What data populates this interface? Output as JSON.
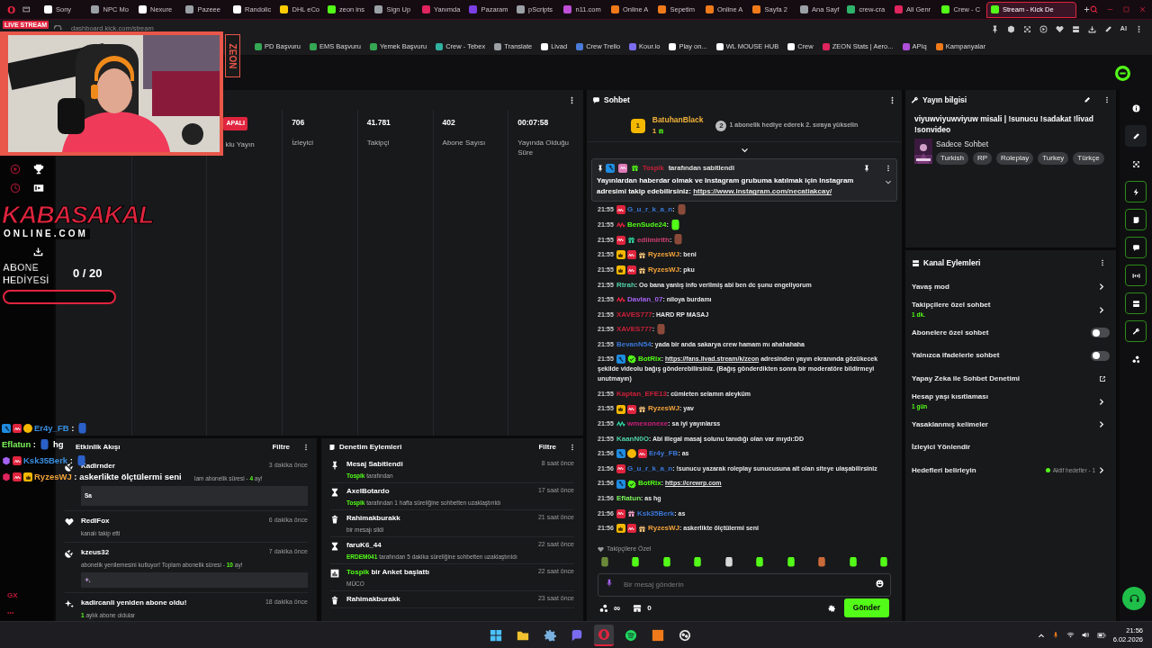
{
  "browser": {
    "tabs": [
      {
        "label": "Sony",
        "color": "#ffffff",
        "selected": false
      },
      {
        "label": "NPC Mo",
        "color": "#9aa0a6",
        "selected": false
      },
      {
        "label": "Nexure",
        "color": "#ffffff",
        "selected": false
      },
      {
        "label": "Pazeee",
        "color": "#9aa0a6",
        "selected": false
      },
      {
        "label": "Randolic",
        "color": "#ffffff",
        "selected": false
      },
      {
        "label": "DHL eCo",
        "color": "#ffcc00",
        "selected": false
      },
      {
        "label": "zeon ins",
        "color": "#53fc18",
        "selected": false
      },
      {
        "label": "Sign Up",
        "color": "#9aa0a6",
        "selected": false
      },
      {
        "label": "Yanımda",
        "color": "#e0245e",
        "selected": false
      },
      {
        "label": "Pazaram",
        "color": "#7b3fe4",
        "selected": false
      },
      {
        "label": "pScripts",
        "color": "#9aa0a6",
        "selected": false
      },
      {
        "label": "n11.com",
        "color": "#c04fd8",
        "selected": false
      },
      {
        "label": "Online A",
        "color": "#f07a1a",
        "selected": false
      },
      {
        "label": "Sepetim",
        "color": "#f07a1a",
        "selected": false
      },
      {
        "label": "Online A",
        "color": "#f07a1a",
        "selected": false
      },
      {
        "label": "Sayfa 2",
        "color": "#f07a1a",
        "selected": false
      },
      {
        "label": "Ana Sayf",
        "color": "#9aa0a6",
        "selected": false
      },
      {
        "label": "crew-cra",
        "color": "#2fb36b",
        "selected": false
      },
      {
        "label": "All Genr",
        "color": "#e0245e",
        "selected": false
      },
      {
        "label": "Crew - C",
        "color": "#53fc18",
        "selected": false
      },
      {
        "label": "Stream - Kick De",
        "color": "#53fc18",
        "selected": true
      }
    ],
    "address": "dashboard.kick.com/stream",
    "ai_label": "AI",
    "bookmarks": [
      {
        "label": "PD Başvuru",
        "color": "#34a853"
      },
      {
        "label": "EMS Başvuru",
        "color": "#34a853"
      },
      {
        "label": "Yemek Başvuru",
        "color": "#34a853"
      },
      {
        "label": "Crew - Tebex",
        "color": "#2fb3a0"
      },
      {
        "label": "Translate",
        "color": "#9aa0a6"
      },
      {
        "label": "Livad",
        "color": "#ffffff"
      },
      {
        "label": "Crew Trello",
        "color": "#4a7bd8"
      },
      {
        "label": "Kour.io",
        "color": "#7b6cf0"
      },
      {
        "label": "Play on...",
        "color": "#ffffff"
      },
      {
        "label": "WL MOUSE HUB",
        "color": "#ffffff"
      },
      {
        "label": "Crew",
        "color": "#ffffff"
      },
      {
        "label": "ZEON Stats | Aero...",
        "color": "#e0245e"
      },
      {
        "label": "APIq",
        "color": "#b04fd8"
      },
      {
        "label": "Kampanyalar",
        "color": "#f07a1a"
      }
    ]
  },
  "overlay": {
    "live_label": "LIVE STREAM",
    "side_tag": "ZEON",
    "brand": "KABASAKAL",
    "brand_sub": "ONLINE.COM",
    "goal_label": "ABONE HEDİYESİ",
    "goal_count": "0 / 20",
    "goal": {
      "level": 0
    },
    "chat": [
      {
        "badges": [
          {
            "kind": "mod",
            "color": "#1f8ce0"
          },
          {
            "kind": "og",
            "color": "#e0243e"
          },
          {
            "kind": "coin",
            "color": "#f5b800"
          }
        ],
        "user": "Er4y_FB",
        "color": "#3a8fe0",
        "parts": [
          {
            "kind": "text",
            "text": " :"
          },
          {
            "kind": "emote",
            "color": "#2a60c8"
          }
        ]
      },
      {
        "user": "Eflatun",
        "color": "#7cf25a",
        "parts": [
          {
            "kind": "text",
            "text": " :"
          },
          {
            "kind": "emote",
            "color": "#2a60c8"
          },
          {
            "kind": "text",
            "text": "hg"
          }
        ]
      },
      {
        "badges": [
          {
            "kind": "cube",
            "color": "#a463f2"
          },
          {
            "kind": "og",
            "color": "#e0243e"
          }
        ],
        "user": "Ksk35Berk",
        "color": "#3a8fe0",
        "parts": [
          {
            "kind": "text",
            "text": " :"
          },
          {
            "kind": "emote",
            "color": "#2a60c8"
          }
        ]
      },
      {
        "badges": [
          {
            "kind": "cube",
            "color": "#e0245e"
          },
          {
            "kind": "og",
            "color": "#e0243e"
          },
          {
            "kind": "crown",
            "color": "#f5b800"
          }
        ],
        "user": "RyzesWJ",
        "color": "#f2a33a",
        "parts": [
          {
            "kind": "text",
            "text": " : askerlikte ölçtülermi seni"
          }
        ]
      }
    ]
  },
  "stats_panel": {
    "status_badge": "APALI",
    "multistream_label": "klu Yayın",
    "stats": [
      {
        "value": "706",
        "label": "İzleyici"
      },
      {
        "value": "41.781",
        "label": "Takipçi"
      },
      {
        "value": "402",
        "label": "Abone Sayısı"
      },
      {
        "value": "00:07:58",
        "label": "Yayında Olduğu Süre"
      }
    ]
  },
  "event_feed": {
    "title": "Etkinlik Akışı",
    "filter": "Filtre",
    "items": [
      {
        "kind": "sub",
        "title": [
          {
            "text": "Kadirnder",
            "highlight": false
          }
        ],
        "time": "3 dakika önce",
        "desc": [
          {
            "text": "lam abonelik süresi - ",
            "highlight": false
          },
          {
            "text": "4",
            "highlight": true
          },
          {
            "text": " ay!",
            "highlight": false
          }
        ],
        "message": "Sa"
      },
      {
        "kind": "follow",
        "title": [
          {
            "text": "RedIFox",
            "highlight": false
          }
        ],
        "time": "6 dakika önce",
        "desc": [
          {
            "text": "kanalı takip etti",
            "highlight": false
          }
        ]
      },
      {
        "kind": "sub",
        "title": [
          {
            "text": "kzeus32",
            "highlight": false
          }
        ],
        "time": "7 dakika önce",
        "desc": [
          {
            "text": "abonelik yenilemesini kutluyor! Toplam abonelik süresi - ",
            "highlight": false
          },
          {
            "text": "10",
            "highlight": true
          },
          {
            "text": " ay!",
            "highlight": false
          }
        ],
        "message_emote": true
      },
      {
        "kind": "resub",
        "title": [
          {
            "text": "kadircanli yeniden abone oldu!",
            "highlight": false
          }
        ],
        "time": "18 dakika önce",
        "desc": [
          {
            "text": "1",
            "highlight": true
          },
          {
            "text": " aylık abone oldular",
            "highlight": false
          }
        ]
      }
    ]
  },
  "moderation": {
    "title": "Denetim Eylemleri",
    "filter": "Filtre",
    "items": [
      {
        "kind": "pin",
        "title": [
          {
            "text": "Mesaj Sabitlendi",
            "highlight": false
          }
        ],
        "time": "8 saat önce",
        "desc": [
          {
            "text": "Tospik",
            "highlight": true
          },
          {
            "text": " tarafından",
            "highlight": false
          }
        ]
      },
      {
        "kind": "timeout",
        "title": [
          {
            "text": "AxelBotardo",
            "highlight": false
          }
        ],
        "time": "17 saat önce",
        "desc": [
          {
            "text": "Tospik",
            "highlight": true
          },
          {
            "text": " tarafından 1 hafta süreliğine sohbetten uzaklaştırıldı",
            "highlight": false
          }
        ]
      },
      {
        "kind": "delete",
        "title": [
          {
            "text": "Rahimakburakk",
            "highlight": false
          }
        ],
        "time": "21 saat önce",
        "desc": [
          {
            "text": "bir mesajı sildi",
            "highlight": false
          }
        ]
      },
      {
        "kind": "timeout",
        "title": [
          {
            "text": "faruK6_44",
            "highlight": false
          }
        ],
        "time": "22 saat önce",
        "desc": [
          {
            "text": "ERDEM041",
            "highlight": true
          },
          {
            "text": " tarafından 5 dakika süreliğine sohbetten uzaklaştırıldı",
            "highlight": false
          }
        ]
      },
      {
        "kind": "poll",
        "title": [
          {
            "text": "Tospik",
            "highlight": true
          },
          {
            "text": " bir Anket başlattı",
            "highlight": false
          }
        ],
        "time": "22 saat önce",
        "desc": [
          {
            "text": "MÜCO",
            "highlight": false
          }
        ]
      },
      {
        "kind": "delete",
        "title": [
          {
            "text": "Rahimakburakk",
            "highlight": false
          }
        ],
        "time": "23 saat önce"
      }
    ]
  },
  "chat": {
    "title": "Sohbet",
    "leader": {
      "rank": "1",
      "user": "BatuhanBlack",
      "count": "1",
      "next_rank": "2",
      "hint": "1 abonelik hediye ederek 2. sıraya yükselin"
    },
    "pinned": {
      "badges": [
        {
          "kind": "mod",
          "color": "#1f8ce0"
        },
        {
          "kind": "og",
          "color": "#e07ab8"
        },
        {
          "kind": "gift",
          "color": "#53fc18"
        }
      ],
      "user": "Tospik",
      "color": "#c8203a",
      "by": "tarafından sabitlendi",
      "parts": [
        {
          "kind": "text",
          "text": "Yayınlardan haberdar olmak ve Instagram grubuma katılmak için Instagram adresimi takip edebilirsiniz: "
        },
        {
          "kind": "link",
          "text": "https://www.instagram.com/necatiakcay/"
        }
      ]
    },
    "messages": [
      {
        "time": "21:55",
        "badges": [
          {
            "kind": "og",
            "color": "#e0243e"
          }
        ],
        "user": "G_u_r_k_a_n",
        "color": "#3a78d8",
        "parts": [
          {
            "kind": "text",
            "text": ":"
          },
          {
            "kind": "emote",
            "color": "#8a4a3a"
          }
        ]
      },
      {
        "time": "21:55",
        "badges": [
          {
            "kind": "squiggle",
            "color": "#e0243e"
          }
        ],
        "user": "BenSude24",
        "color": "#53fc18",
        "parts": [
          {
            "kind": "text",
            "text": ":"
          },
          {
            "kind": "emote",
            "color": "#53fc18"
          }
        ]
      },
      {
        "time": "21:55",
        "badges": [
          {
            "kind": "og",
            "color": "#e0243e"
          },
          {
            "kind": "gift",
            "color": "#2fd3a0"
          }
        ],
        "user": "ediimirith",
        "color": "#d04070",
        "parts": [
          {
            "kind": "text",
            "text": ":"
          },
          {
            "kind": "emote",
            "color": "#8a4a3a"
          }
        ]
      },
      {
        "time": "21:55",
        "badges": [
          {
            "kind": "crown",
            "color": "#f5b800"
          },
          {
            "kind": "og",
            "color": "#e0243e"
          },
          {
            "kind": "gift",
            "color": "#f2c27a"
          }
        ],
        "user": "RyzesWJ",
        "color": "#f2a33a",
        "parts": [
          {
            "kind": "text",
            "text": ": beni"
          }
        ]
      },
      {
        "time": "21:55",
        "badges": [
          {
            "kind": "crown",
            "color": "#f5b800"
          },
          {
            "kind": "og",
            "color": "#e0243e"
          },
          {
            "kind": "gift",
            "color": "#f2c27a"
          }
        ],
        "user": "RyzesWJ",
        "color": "#f2a33a",
        "parts": [
          {
            "kind": "text",
            "text": ": pku"
          }
        ]
      },
      {
        "time": "21:55",
        "user": "Rtrah",
        "color": "#4fd1a5",
        "parts": [
          {
            "kind": "text",
            "text": ": Oo bana yanlış info verilmiş abi ben dc şunu engeliyorum"
          }
        ]
      },
      {
        "time": "21:55",
        "badges": [
          {
            "kind": "squiggle",
            "color": "#e0243e"
          }
        ],
        "user": "Davlan_07",
        "color": "#a463f2",
        "parts": [
          {
            "kind": "text",
            "text": ": niloya burdamı"
          }
        ]
      },
      {
        "time": "21:55",
        "user": "XAVES777",
        "color": "#c8203a",
        "parts": [
          {
            "kind": "text",
            "text": ": HARD RP MASAJ"
          }
        ]
      },
      {
        "time": "21:55",
        "user": "XAVES777",
        "color": "#c8203a",
        "parts": [
          {
            "kind": "text",
            "text": ":"
          },
          {
            "kind": "emote",
            "color": "#8a4a3a"
          }
        ]
      },
      {
        "time": "21:55",
        "user": "BevanN54",
        "color": "#3a78d8",
        "parts": [
          {
            "kind": "text",
            "text": ": yada bir anda sakarya crew hamam mı ahahahaha"
          }
        ]
      },
      {
        "time": "21:55",
        "badges": [
          {
            "kind": "mod",
            "color": "#1f8ce0"
          },
          {
            "kind": "verified",
            "color": "#53fc18"
          }
        ],
        "user": "BotRix",
        "color": "#53fc18",
        "parts": [
          {
            "kind": "text",
            "text": ": "
          },
          {
            "kind": "link",
            "text": "https://fans.livad.stream/k/zeon"
          },
          {
            "kind": "text",
            "text": " adresinden yayın ekranında gözükecek şekilde videolu bağış gönderebilirsiniz. (Bağış gönderdikten sonra bir moderatöre bildirmeyi unutmayın)"
          }
        ]
      },
      {
        "time": "21:55",
        "user": "Kaptan_EFE13",
        "color": "#c8203a",
        "parts": [
          {
            "kind": "text",
            "text": ": cümleten selamın aleyküm"
          }
        ]
      },
      {
        "time": "21:55",
        "badges": [
          {
            "kind": "crown",
            "color": "#f5b800"
          },
          {
            "kind": "og",
            "color": "#e0243e"
          },
          {
            "kind": "gift",
            "color": "#f2c27a"
          }
        ],
        "user": "RyzesWJ",
        "color": "#f2a33a",
        "parts": [
          {
            "kind": "text",
            "text": ": yav"
          }
        ]
      },
      {
        "time": "21:55",
        "badges": [
          {
            "kind": "squiggle",
            "color": "#2fd3a0"
          }
        ],
        "user": "wmexonexe",
        "color": "#c8207a",
        "parts": [
          {
            "kind": "text",
            "text": ": sa iyi yayınlarss"
          }
        ]
      },
      {
        "time": "21:55",
        "user": "KaanN0O",
        "color": "#4fd1a5",
        "parts": [
          {
            "kind": "text",
            "text": ": Abi illegal masaj solunu tanıdığı olan var mıydı:DD"
          }
        ]
      },
      {
        "time": "21:56",
        "badges": [
          {
            "kind": "mod",
            "color": "#1f8ce0"
          },
          {
            "kind": "coin",
            "color": "#f5b800"
          },
          {
            "kind": "og",
            "color": "#e0243e"
          }
        ],
        "user": "Er4y_FB",
        "color": "#3a78d8",
        "parts": [
          {
            "kind": "text",
            "text": ": as"
          }
        ]
      },
      {
        "time": "21:56",
        "badges": [
          {
            "kind": "og",
            "color": "#e0243e"
          }
        ],
        "user": "G_u_r_k_a_n",
        "color": "#3a78d8",
        "parts": [
          {
            "kind": "text",
            "text": ": !sunucu yazarak roleplay sunucusuna ait olan siteye ulaşabilirsiniz"
          }
        ]
      },
      {
        "time": "21:56",
        "badges": [
          {
            "kind": "mod",
            "color": "#1f8ce0"
          },
          {
            "kind": "verified",
            "color": "#53fc18"
          }
        ],
        "user": "BotRix",
        "color": "#53fc18",
        "parts": [
          {
            "kind": "text",
            "text": ": "
          },
          {
            "kind": "link",
            "text": "https://crewrp.com"
          }
        ]
      },
      {
        "time": "21:56",
        "user": "Eflatun",
        "color": "#7cf25a",
        "parts": [
          {
            "kind": "text",
            "text": ": as hg"
          }
        ]
      },
      {
        "time": "21:56",
        "badges": [
          {
            "kind": "og",
            "color": "#e0243e"
          },
          {
            "kind": "gift",
            "color": "#f2a0c8"
          }
        ],
        "user": "Ksk35Berk",
        "color": "#3a78d8",
        "parts": [
          {
            "kind": "text",
            "text": ": as"
          }
        ]
      },
      {
        "time": "21:56",
        "badges": [
          {
            "kind": "crown",
            "color": "#f5b800"
          },
          {
            "kind": "og",
            "color": "#e0243e"
          },
          {
            "kind": "gift",
            "color": "#f2c27a"
          }
        ],
        "user": "RyzesWJ",
        "color": "#f2a33a",
        "parts": [
          {
            "kind": "text",
            "text": ": askerlikte ölçtülermi seni"
          }
        ]
      }
    ],
    "emotes_label": "Takipçilere Özel",
    "emotes": [
      {
        "color": "#6a8a3a"
      },
      {
        "color": "#53fc18"
      },
      {
        "color": "#53fc18"
      },
      {
        "color": "#53fc18"
      },
      {
        "color": "#d8d8d8"
      },
      {
        "color": "#53fc18"
      },
      {
        "color": "#53fc18"
      },
      {
        "color": "#c86a3a"
      },
      {
        "color": "#53fc18"
      },
      {
        "color": "#53fc18"
      }
    ],
    "input": {
      "placeholder": "Bir mesaj gönderin"
    },
    "points": "∞",
    "store_count": "0",
    "send": "Gönder"
  },
  "stream_info": {
    "title": "Yayın bilgisi",
    "stream_title": "viyuwviyuwviyuw misali | !sunucu !sadakat !livad !sonvideo",
    "category": "Sadece Sohbet",
    "tags": [
      "Turkish",
      "RP",
      "Roleplay",
      "Turkey",
      "Türkçe"
    ]
  },
  "channel_actions": {
    "title": "Kanal Eylemleri",
    "items": [
      {
        "kind": "arrow",
        "label": "Yavaş mod"
      },
      {
        "kind": "arrow",
        "label": "Takipçilere özel sohbet",
        "detail": "1 dk."
      },
      {
        "kind": "toggle",
        "label": "Abonelere özel sohbet",
        "on": false
      },
      {
        "kind": "toggle",
        "label": "Yalnızca ifadelerle sohbet",
        "on": false
      },
      {
        "kind": "external",
        "label": "Yapay Zeka ile Sohbet Denetimi"
      },
      {
        "kind": "arrow",
        "label": "Hesap yaşı kısıtlaması",
        "detail": "1 gün"
      },
      {
        "kind": "arrow",
        "label": "Yasaklanmış kelimeler"
      },
      {
        "kind": "plain",
        "label": "İzleyici Yönlendir"
      },
      {
        "kind": "goal",
        "label": "Hedefleri belirleyin",
        "status": "Aktif hedefler - 1"
      }
    ]
  },
  "rail": [
    {
      "kind": "info",
      "highlighted": false,
      "selected": false
    },
    {
      "kind": "pencil",
      "highlighted": false,
      "selected": true
    },
    {
      "kind": "focus",
      "highlighted": false,
      "selected": false
    },
    {
      "kind": "bolt",
      "highlighted": true,
      "selected": false
    },
    {
      "kind": "note",
      "highlighted": true,
      "selected": false
    },
    {
      "kind": "chat",
      "highlighted": true,
      "selected": false
    },
    {
      "kind": "split",
      "highlighted": true,
      "selected": false
    },
    {
      "kind": "panel",
      "highlighted": true,
      "selected": false
    },
    {
      "kind": "wrench",
      "highlighted": true,
      "selected": false
    },
    {
      "kind": "nodes",
      "highlighted": false,
      "selected": false
    }
  ],
  "sidebar": {
    "bottom_label": "GX",
    "more": "•••"
  },
  "taskbar": {
    "apps": [
      {
        "kind": "windows",
        "active": false
      },
      {
        "kind": "folder",
        "active": false
      },
      {
        "kind": "gear",
        "active": false
      },
      {
        "kind": "chatapp",
        "active": false
      },
      {
        "kind": "browser",
        "active": true
      },
      {
        "kind": "music",
        "active": false
      },
      {
        "kind": "tool",
        "active": false
      },
      {
        "kind": "recorder",
        "active": false
      }
    ],
    "time": "21:56",
    "date": "6.02.2026"
  }
}
